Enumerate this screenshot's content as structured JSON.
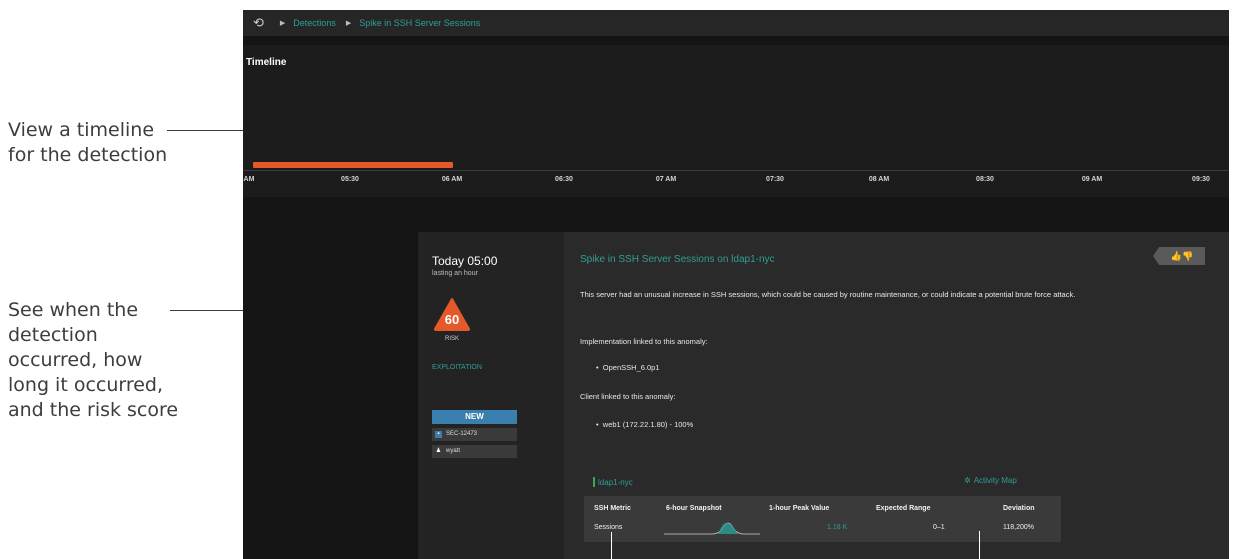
{
  "callouts": {
    "timeline": "View a timeline\nfor the detection",
    "when": "See when the\ndetection\noccurred, how\nlong it occurred,\nand the risk score"
  },
  "breadcrumb": {
    "home_icon": "history-icon",
    "items": [
      "Detections",
      "Spike in SSH Server Sessions"
    ]
  },
  "timeline": {
    "title": "Timeline",
    "ticks": [
      "AM",
      "05:30",
      "06 AM",
      "06:30",
      "07 AM",
      "07:30",
      "08 AM",
      "08:30",
      "09 AM",
      "09:30"
    ]
  },
  "detection": {
    "when": "Today 05:00",
    "duration": "lasting an hour",
    "risk_score": "60",
    "risk_label": "RISK",
    "category": "EXPLOITATION",
    "status": "NEW",
    "ticket": "SEC-12473",
    "assignee": "wyatt",
    "title": "Spike in SSH Server Sessions on ldap1-nyc",
    "description": "This server had an unusual increase in SSH sessions, which could be caused by routine maintenance, or could indicate a potential brute force attack.",
    "impl_heading": "Implementation linked to this anomaly:",
    "impl_item": "OpenSSH_6.0p1",
    "client_heading": "Client linked to this anomaly:",
    "client_item": "web1 (172.22.1.80) - 100%",
    "device": "ldap1-nyc",
    "activity_map": "Activity Map"
  },
  "metrics": {
    "headers": [
      "SSH Metric",
      "6-hour Snapshot",
      "1-hour Peak Value",
      "Expected Range",
      "Deviation"
    ],
    "row": {
      "metric": "Sessions",
      "peak": "1.18 K",
      "range": "0–1",
      "deviation": "118,200%"
    }
  },
  "colors": {
    "accent": "#2f9e96",
    "risk": "#e4592a",
    "status": "#3a7fae"
  }
}
